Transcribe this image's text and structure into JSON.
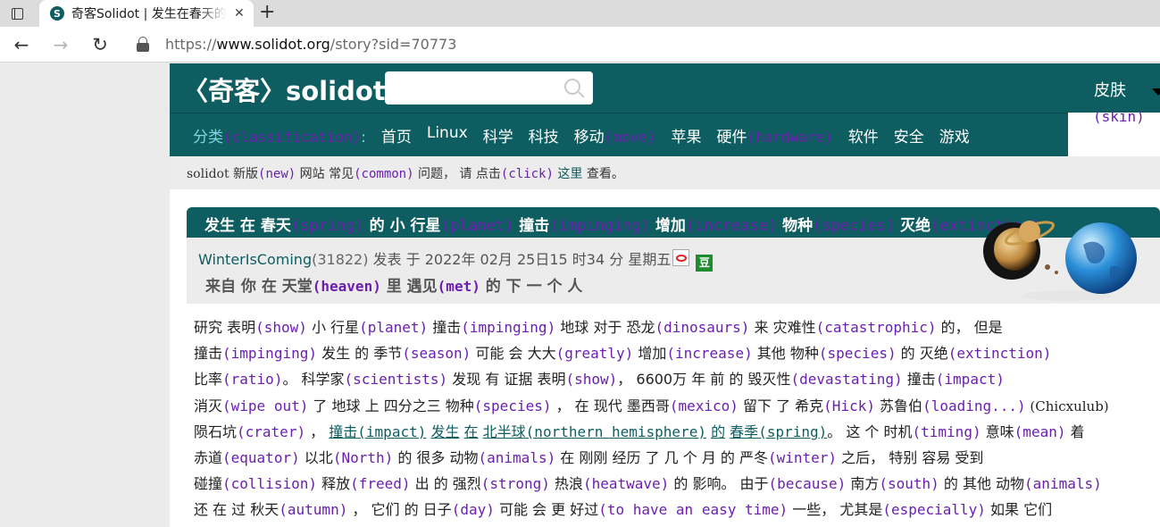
{
  "browser": {
    "tab_title": "奇客Solidot | 发生在春天的",
    "favicon_letter": "S",
    "tab_close": "✕",
    "new_tab": "+",
    "url_prefix": "https://",
    "url_host": "www.solidot.org",
    "url_path": "/story?sid=70773"
  },
  "site": {
    "logo": "〈奇客〉solidot",
    "skin_label": "皮肤",
    "skin_ann": "(skin)"
  },
  "nav": {
    "category": "分类",
    "category_ann": "(classification)",
    "category_colon": ":",
    "items": [
      {
        "label": "首页",
        "ann": ""
      },
      {
        "label": "Linux",
        "ann": ""
      },
      {
        "label": "科学",
        "ann": ""
      },
      {
        "label": "科技",
        "ann": ""
      },
      {
        "label": "移动",
        "ann": "(move)"
      },
      {
        "label": "苹果",
        "ann": ""
      },
      {
        "label": "硬件",
        "ann": "(hardware)"
      },
      {
        "label": "软件",
        "ann": ""
      },
      {
        "label": "安全",
        "ann": ""
      },
      {
        "label": "游戏",
        "ann": ""
      }
    ]
  },
  "notice": {
    "p1": "solidot",
    "p2": " 新版",
    "a1": "(new)",
    "p3": " 网站 常见",
    "a2": "(common)",
    "p4": " 问题， 请 点击",
    "a3": "(click)",
    "link": " 这里",
    "p5": " 查看。"
  },
  "story": {
    "title_segments": [
      {
        "t": "发生 在 春天",
        "a": "(spring)"
      },
      {
        "t": " 的 小 行星",
        "a": "(planet)"
      },
      {
        "t": " 撞击",
        "a": "(impinging)"
      },
      {
        "t": " 增加",
        "a": "(increase)"
      },
      {
        "t": " 物种",
        "a": "(species)"
      },
      {
        "t": " 灭绝",
        "a": "(extinction)"
      }
    ],
    "author": "WinterIsComing",
    "author_count": "(31822)",
    "posted": " 发表  于  2022年  02月  25日15  时34  分  星期五",
    "douban": "豆",
    "subtitle_p1": "来自  你  在  天堂",
    "subtitle_a1": "(heaven)",
    "subtitle_p2": " 里  遇见",
    "subtitle_a2": "(met)",
    "subtitle_p3": " 的  下  一  个  人"
  },
  "article": {
    "lines": [
      [
        [
          "t",
          "研究  表明"
        ],
        [
          "a",
          "(show)"
        ],
        [
          "t",
          " 小  行星"
        ],
        [
          "a",
          "(planet)"
        ],
        [
          "t",
          " 撞击"
        ],
        [
          "a",
          "(impinging)"
        ],
        [
          "t",
          " 地球  对于  恐龙"
        ],
        [
          "a",
          "(dinosaurs)"
        ],
        [
          "t",
          " 来  灾难性"
        ],
        [
          "a",
          "(catastrophic)"
        ],
        [
          "t",
          " 的，  但是"
        ]
      ],
      [
        [
          "t",
          "撞击"
        ],
        [
          "a",
          "(impinging)"
        ],
        [
          "t",
          " 发生  的  季节"
        ],
        [
          "a",
          "(season)"
        ],
        [
          "t",
          " 可能  会  大大"
        ],
        [
          "a",
          "(greatly)"
        ],
        [
          "t",
          " 增加"
        ],
        [
          "a",
          "(increase)"
        ],
        [
          "t",
          " 其他  物种"
        ],
        [
          "a",
          "(species)"
        ],
        [
          "t",
          " 的  灭绝"
        ],
        [
          "a",
          "(extinction)"
        ]
      ],
      [
        [
          "t",
          "比率"
        ],
        [
          "a",
          "(ratio)"
        ],
        [
          "t",
          "。 科学家"
        ],
        [
          "a",
          "(scientists)"
        ],
        [
          "t",
          " 发现  有  证据  表明"
        ],
        [
          "a",
          "(show)"
        ],
        [
          "t",
          "，  6600万  年  前  的  毁灭性"
        ],
        [
          "a",
          "(devastating)"
        ],
        [
          "t",
          " 撞击"
        ],
        [
          "a",
          "(impact)"
        ]
      ],
      [
        [
          "t",
          "消灭"
        ],
        [
          "a",
          "(wipe out)"
        ],
        [
          "t",
          " 了  地球  上  四分之三  物种"
        ],
        [
          "a",
          "(species)"
        ],
        [
          "t",
          " ，  在  现代  墨西哥"
        ],
        [
          "a",
          "(mexico)"
        ],
        [
          "t",
          " 留下  了  希克"
        ],
        [
          "a",
          "(Hick)"
        ],
        [
          "t",
          " 苏鲁伯"
        ],
        [
          "a",
          "(loading...)"
        ],
        [
          "l",
          " (Chicxulub)"
        ]
      ],
      [
        [
          "t",
          "陨石坑"
        ],
        [
          "a",
          "(crater)"
        ],
        [
          "t",
          " ，  "
        ],
        [
          "k",
          "撞击"
        ],
        [
          "ka",
          "(impact)"
        ],
        [
          "t",
          " "
        ],
        [
          "k",
          "发生"
        ],
        [
          "t",
          " "
        ],
        [
          "k",
          "在"
        ],
        [
          "t",
          " "
        ],
        [
          "k",
          "北半球"
        ],
        [
          "ka",
          "(northern hemisphere)"
        ],
        [
          "t",
          " "
        ],
        [
          "k",
          "的"
        ],
        [
          "t",
          " "
        ],
        [
          "k",
          "春季"
        ],
        [
          "ka",
          "(spring)"
        ],
        [
          "t",
          "。  这  个  时机"
        ],
        [
          "a",
          "(timing)"
        ],
        [
          "t",
          " 意味"
        ],
        [
          "a",
          "(mean)"
        ],
        [
          "t",
          " 着"
        ]
      ],
      [
        [
          "t",
          "赤道"
        ],
        [
          "a",
          "(equator)"
        ],
        [
          "t",
          " 以北"
        ],
        [
          "a",
          "(North)"
        ],
        [
          "t",
          " 的  很多  动物"
        ],
        [
          "a",
          "(animals)"
        ],
        [
          "t",
          " 在  刚刚  经历  了  几  个  月  的  严冬"
        ],
        [
          "a",
          "(winter)"
        ],
        [
          "t",
          " 之后，  特别  容易  受到"
        ]
      ],
      [
        [
          "t",
          "碰撞"
        ],
        [
          "a",
          "(collision)"
        ],
        [
          "t",
          " 释放"
        ],
        [
          "a",
          "(freed)"
        ],
        [
          "t",
          " 出  的  强烈"
        ],
        [
          "a",
          "(strong)"
        ],
        [
          "t",
          " 热浪"
        ],
        [
          "a",
          "(heatwave)"
        ],
        [
          "t",
          " 的  影响。  由于"
        ],
        [
          "a",
          "(because)"
        ],
        [
          "t",
          " 南方"
        ],
        [
          "a",
          "(south)"
        ],
        [
          "t",
          " 的  其他  动物"
        ],
        [
          "a",
          "(animals)"
        ]
      ],
      [
        [
          "t",
          "还  在  过  秋天"
        ],
        [
          "a",
          "(autumn)"
        ],
        [
          "t",
          " ，  它们  的  日子"
        ],
        [
          "a",
          "(day)"
        ],
        [
          "t",
          " 可能  会  更  好过"
        ],
        [
          "a",
          "(to have an easy time)"
        ],
        [
          "t",
          " 一些，  尤其是"
        ],
        [
          "a",
          "(especially)"
        ],
        [
          "t",
          " 如果  它们"
        ]
      ]
    ]
  }
}
